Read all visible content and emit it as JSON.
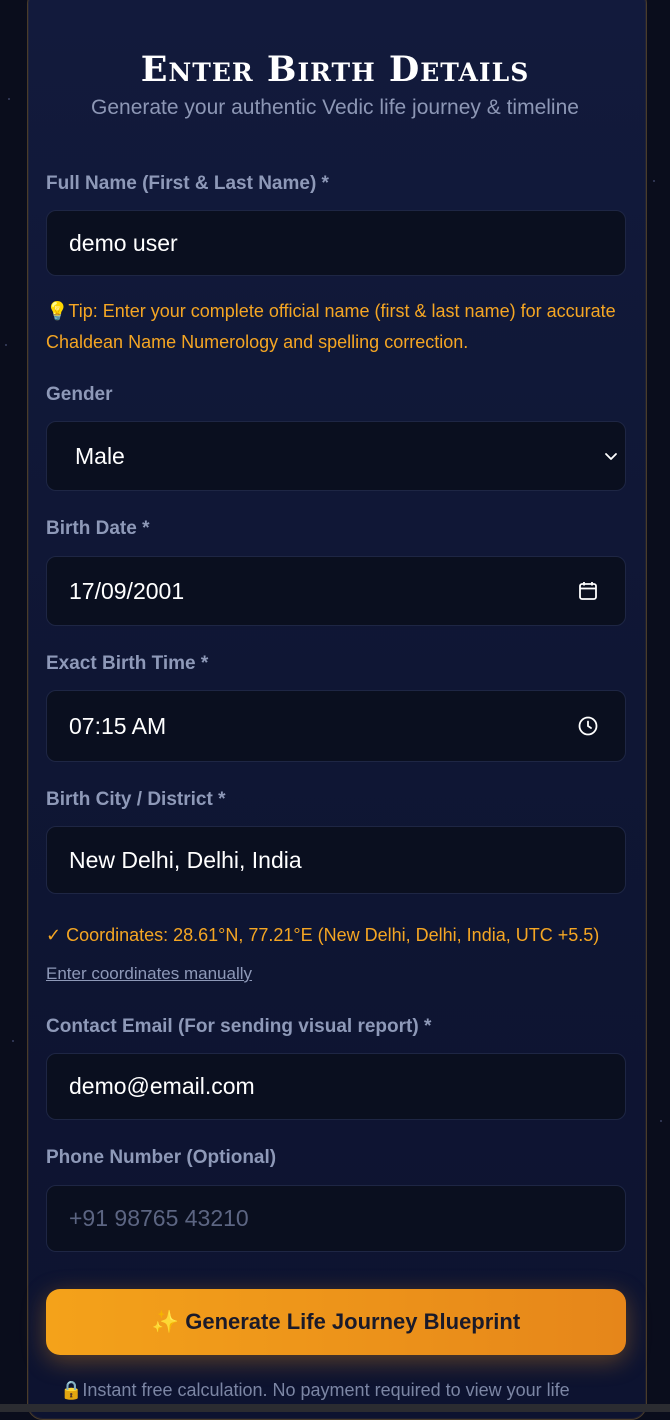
{
  "header": {
    "title": "Enter Birth Details",
    "subtitle": "Generate your authentic Vedic life journey & timeline"
  },
  "fields": {
    "full_name": {
      "label": "Full Name (First & Last Name) *",
      "value": "demo user"
    },
    "tip": {
      "icon": "lightbulb-icon",
      "text": "💡Tip: Enter your complete official name (first & last name) for accurate Chaldean Name Numerology and spelling correction."
    },
    "gender": {
      "label": "Gender",
      "selected": "Male",
      "icon": "chevron-down-icon"
    },
    "birth_date": {
      "label": "Birth Date *",
      "value": "17/09/2001",
      "icon": "calendar-icon"
    },
    "birth_time": {
      "label": "Exact Birth Time *",
      "value": "07:15 AM",
      "icon": "clock-icon"
    },
    "birth_city": {
      "label": "Birth City / District *",
      "value": "New Delhi, Delhi, India"
    },
    "coordinates": {
      "text": "✓ Coordinates: 28.61°N, 77.21°E (New Delhi, Delhi, India, UTC +5.5)"
    },
    "manual_link": "Enter coordinates manually",
    "email": {
      "label": "Contact Email (For sending visual report) *",
      "value": "demo@email.com"
    },
    "phone": {
      "label": "Phone Number (Optional)",
      "placeholder": "+91 98765 43210"
    }
  },
  "cta": {
    "icon": "sparkles-icon",
    "label": "Generate Life Journey Blueprint"
  },
  "footer": {
    "icon": "lock-icon",
    "text": "🔒Instant free calculation. No payment required to view your life"
  },
  "colors": {
    "accent": "#f5a623",
    "background": "#0a0d1c",
    "panel": "#121a3c",
    "field": "#0a0f1f"
  }
}
